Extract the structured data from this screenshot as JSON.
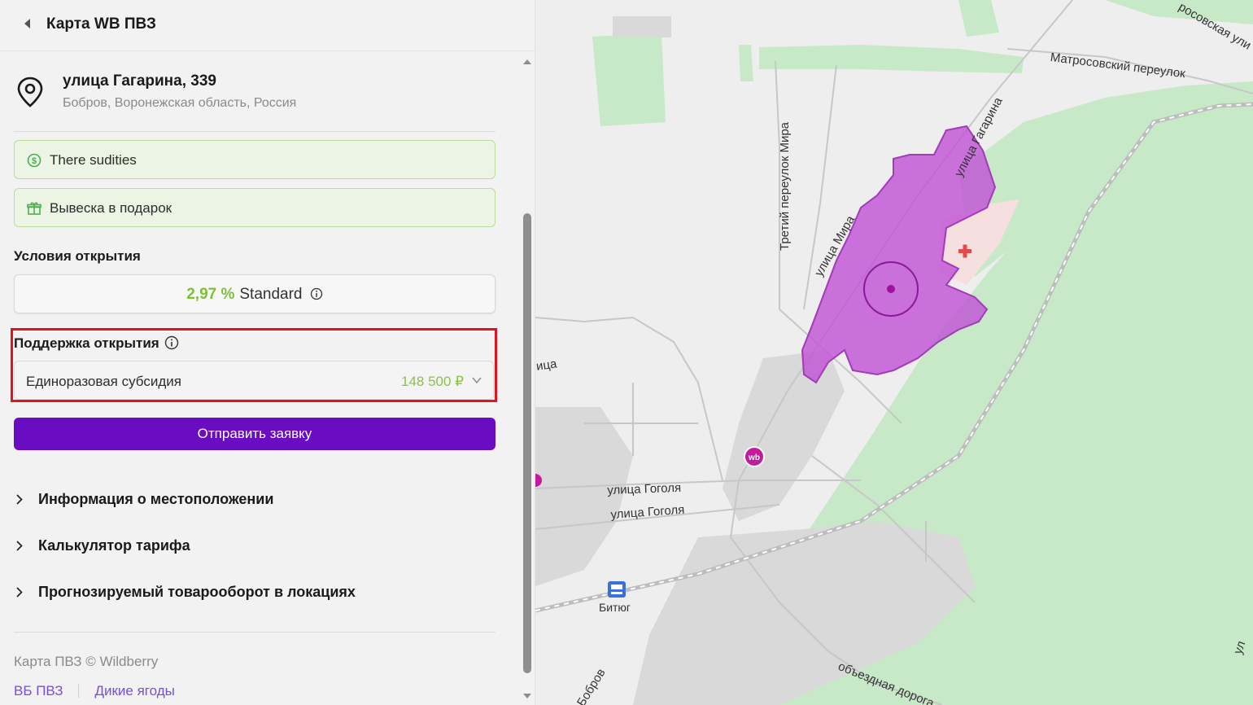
{
  "header": {
    "title": "Карта WB ПВЗ"
  },
  "address": {
    "title": "улица Гагарина, 339",
    "subtitle": "Бобров, Воронежская область, Россия"
  },
  "chips": [
    {
      "label": "There sudities",
      "icon": "dollar-coin-icon"
    },
    {
      "label": "Вывеска в подарок",
      "icon": "gift-icon"
    }
  ],
  "conditions": {
    "heading": "Условия открытия",
    "rate": "2,97 %",
    "tariff": "Standard"
  },
  "support": {
    "heading": "Поддержка открытия",
    "option_label": "Единоразовая субсидия",
    "option_value": "148 500 ₽"
  },
  "submit_label": "Отправить заявку",
  "accordions": [
    {
      "label": "Информация о местоположении"
    },
    {
      "label": "Калькулятор тарифа"
    },
    {
      "label": "Прогнозируемый товарооборот в локациях"
    }
  ],
  "footer": {
    "copyright": "Карта ПВЗ © Wildberry",
    "link1": "ВБ ПВЗ",
    "link2": "Дикие ягоды"
  },
  "map": {
    "streets": [
      {
        "label": "Матросовский переулок"
      },
      {
        "label": "росовская ули"
      },
      {
        "label": "улица Гагарина"
      },
      {
        "label": "Третий переулок Мира"
      },
      {
        "label": "улица Мира"
      },
      {
        "label": "ица"
      },
      {
        "label": "улица Гоголя"
      },
      {
        "label": "улица Гоголя"
      },
      {
        "label": "Битюг"
      },
      {
        "label": "Бобров"
      },
      {
        "label": "объездная дорога"
      },
      {
        "label": "ул"
      }
    ],
    "marker_label": "wb",
    "colors": {
      "zone": "#c154d6",
      "green": "#c8e9c8",
      "gray": "#d6d6d6",
      "brand": "#c21b9e"
    }
  }
}
